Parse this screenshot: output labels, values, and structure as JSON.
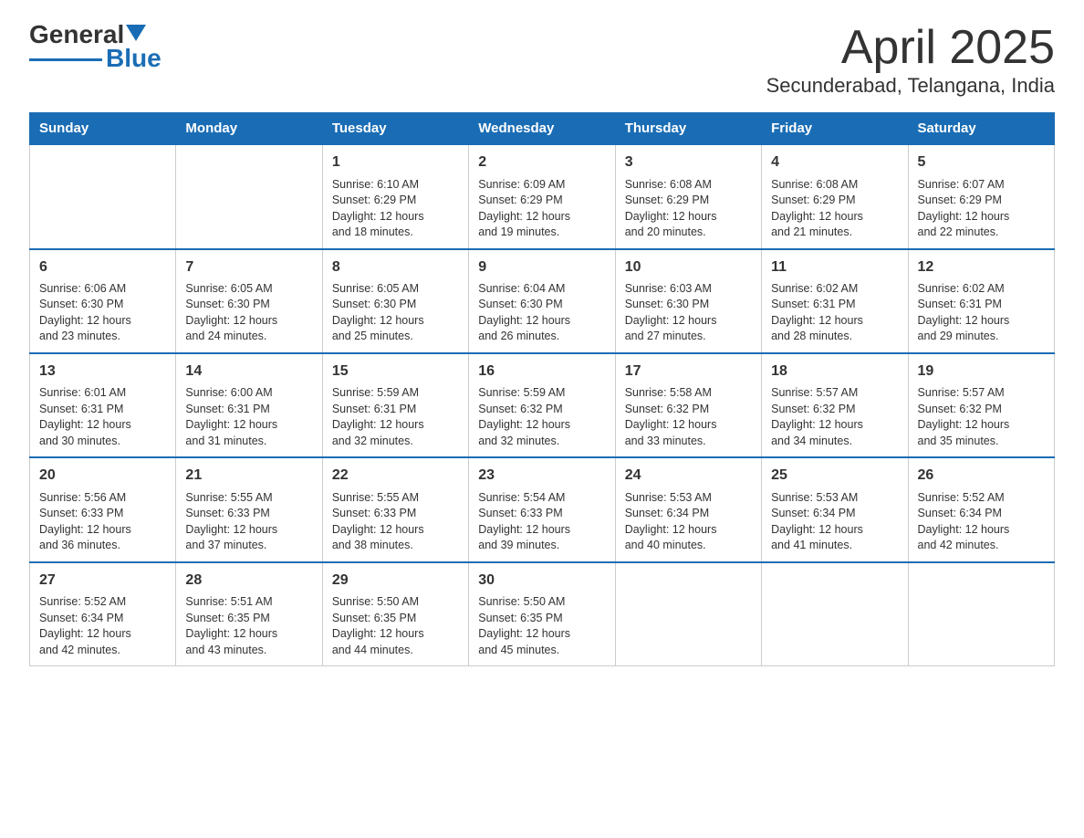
{
  "header": {
    "logo_text_black": "General",
    "logo_text_blue": "Blue",
    "title": "April 2025",
    "subtitle": "Secunderabad, Telangana, India"
  },
  "weekdays": [
    "Sunday",
    "Monday",
    "Tuesday",
    "Wednesday",
    "Thursday",
    "Friday",
    "Saturday"
  ],
  "weeks": [
    [
      {
        "day": "",
        "info": ""
      },
      {
        "day": "",
        "info": ""
      },
      {
        "day": "1",
        "info": "Sunrise: 6:10 AM\nSunset: 6:29 PM\nDaylight: 12 hours\nand 18 minutes."
      },
      {
        "day": "2",
        "info": "Sunrise: 6:09 AM\nSunset: 6:29 PM\nDaylight: 12 hours\nand 19 minutes."
      },
      {
        "day": "3",
        "info": "Sunrise: 6:08 AM\nSunset: 6:29 PM\nDaylight: 12 hours\nand 20 minutes."
      },
      {
        "day": "4",
        "info": "Sunrise: 6:08 AM\nSunset: 6:29 PM\nDaylight: 12 hours\nand 21 minutes."
      },
      {
        "day": "5",
        "info": "Sunrise: 6:07 AM\nSunset: 6:29 PM\nDaylight: 12 hours\nand 22 minutes."
      }
    ],
    [
      {
        "day": "6",
        "info": "Sunrise: 6:06 AM\nSunset: 6:30 PM\nDaylight: 12 hours\nand 23 minutes."
      },
      {
        "day": "7",
        "info": "Sunrise: 6:05 AM\nSunset: 6:30 PM\nDaylight: 12 hours\nand 24 minutes."
      },
      {
        "day": "8",
        "info": "Sunrise: 6:05 AM\nSunset: 6:30 PM\nDaylight: 12 hours\nand 25 minutes."
      },
      {
        "day": "9",
        "info": "Sunrise: 6:04 AM\nSunset: 6:30 PM\nDaylight: 12 hours\nand 26 minutes."
      },
      {
        "day": "10",
        "info": "Sunrise: 6:03 AM\nSunset: 6:30 PM\nDaylight: 12 hours\nand 27 minutes."
      },
      {
        "day": "11",
        "info": "Sunrise: 6:02 AM\nSunset: 6:31 PM\nDaylight: 12 hours\nand 28 minutes."
      },
      {
        "day": "12",
        "info": "Sunrise: 6:02 AM\nSunset: 6:31 PM\nDaylight: 12 hours\nand 29 minutes."
      }
    ],
    [
      {
        "day": "13",
        "info": "Sunrise: 6:01 AM\nSunset: 6:31 PM\nDaylight: 12 hours\nand 30 minutes."
      },
      {
        "day": "14",
        "info": "Sunrise: 6:00 AM\nSunset: 6:31 PM\nDaylight: 12 hours\nand 31 minutes."
      },
      {
        "day": "15",
        "info": "Sunrise: 5:59 AM\nSunset: 6:31 PM\nDaylight: 12 hours\nand 32 minutes."
      },
      {
        "day": "16",
        "info": "Sunrise: 5:59 AM\nSunset: 6:32 PM\nDaylight: 12 hours\nand 32 minutes."
      },
      {
        "day": "17",
        "info": "Sunrise: 5:58 AM\nSunset: 6:32 PM\nDaylight: 12 hours\nand 33 minutes."
      },
      {
        "day": "18",
        "info": "Sunrise: 5:57 AM\nSunset: 6:32 PM\nDaylight: 12 hours\nand 34 minutes."
      },
      {
        "day": "19",
        "info": "Sunrise: 5:57 AM\nSunset: 6:32 PM\nDaylight: 12 hours\nand 35 minutes."
      }
    ],
    [
      {
        "day": "20",
        "info": "Sunrise: 5:56 AM\nSunset: 6:33 PM\nDaylight: 12 hours\nand 36 minutes."
      },
      {
        "day": "21",
        "info": "Sunrise: 5:55 AM\nSunset: 6:33 PM\nDaylight: 12 hours\nand 37 minutes."
      },
      {
        "day": "22",
        "info": "Sunrise: 5:55 AM\nSunset: 6:33 PM\nDaylight: 12 hours\nand 38 minutes."
      },
      {
        "day": "23",
        "info": "Sunrise: 5:54 AM\nSunset: 6:33 PM\nDaylight: 12 hours\nand 39 minutes."
      },
      {
        "day": "24",
        "info": "Sunrise: 5:53 AM\nSunset: 6:34 PM\nDaylight: 12 hours\nand 40 minutes."
      },
      {
        "day": "25",
        "info": "Sunrise: 5:53 AM\nSunset: 6:34 PM\nDaylight: 12 hours\nand 41 minutes."
      },
      {
        "day": "26",
        "info": "Sunrise: 5:52 AM\nSunset: 6:34 PM\nDaylight: 12 hours\nand 42 minutes."
      }
    ],
    [
      {
        "day": "27",
        "info": "Sunrise: 5:52 AM\nSunset: 6:34 PM\nDaylight: 12 hours\nand 42 minutes."
      },
      {
        "day": "28",
        "info": "Sunrise: 5:51 AM\nSunset: 6:35 PM\nDaylight: 12 hours\nand 43 minutes."
      },
      {
        "day": "29",
        "info": "Sunrise: 5:50 AM\nSunset: 6:35 PM\nDaylight: 12 hours\nand 44 minutes."
      },
      {
        "day": "30",
        "info": "Sunrise: 5:50 AM\nSunset: 6:35 PM\nDaylight: 12 hours\nand 45 minutes."
      },
      {
        "day": "",
        "info": ""
      },
      {
        "day": "",
        "info": ""
      },
      {
        "day": "",
        "info": ""
      }
    ]
  ]
}
